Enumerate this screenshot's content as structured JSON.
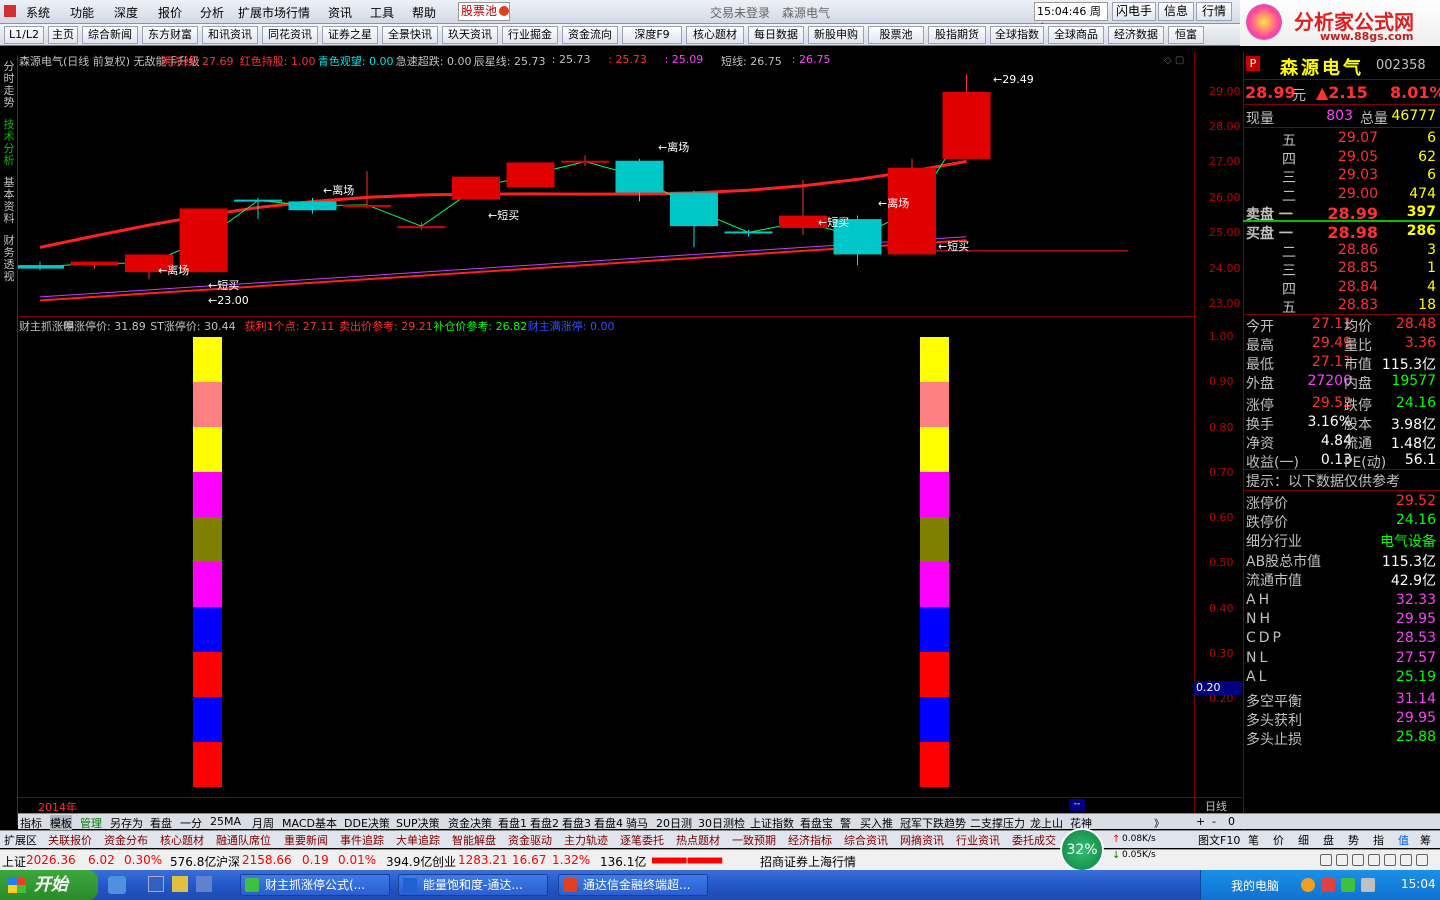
{
  "menu": {
    "items": [
      "系统",
      "功能",
      "深度",
      "报价",
      "分析",
      "扩展市场行情",
      "资讯",
      "工具",
      "帮助"
    ],
    "stockpool": "股票池",
    "status_text": "交易未登录",
    "stock_title": "森源电气",
    "time": "15:04:46",
    "weekday": "周六",
    "right_buttons": [
      "闪电手",
      "信息",
      "行情"
    ],
    "logo": "分析家公式网",
    "logo_url": "www.88gs.com"
  },
  "toolbar": {
    "items": [
      "L1/L2",
      "主页",
      "综合新闻",
      "东方财富",
      "和讯资讯",
      "同花资讯",
      "证券之星",
      "全景快讯",
      "玖天资讯",
      "行业掘金",
      "资金流向",
      "深度F9",
      "核心题材",
      "每日数据",
      "新股申购",
      "股票池",
      "股指期货",
      "全球指数",
      "全球商品",
      "经济数据",
      "恒富"
    ]
  },
  "sidebar": {
    "tabs": [
      "分时走势",
      "技术分析",
      "基本资料",
      "财务透视"
    ]
  },
  "main_chart": {
    "header": [
      {
        "text": "森源电气(日线 前复权) 无敌能手升级",
        "color": "#c0c0c0"
      },
      {
        "text": "拥杀线: 27.69",
        "color": "#ff3030"
      },
      {
        "text": "红色持股: 1.00",
        "color": "#ff3030"
      },
      {
        "text": "青色观望: 0.00",
        "color": "#00e0e0"
      },
      {
        "text": "急速超跌: 0.00",
        "color": "#c0c0c0"
      },
      {
        "text": "辰星线: 25.73",
        "color": "#c0c0c0"
      },
      {
        "text": ": 25.73",
        "color": "#c0c0c0"
      },
      {
        "text": ": 25.73",
        "color": "#ff3030"
      },
      {
        "text": ": 25.09",
        "color": "#ff40ff"
      },
      {
        "text": "短线: 26.75",
        "color": "#c0c0c0"
      },
      {
        "text": ": 26.75",
        "color": "#ff40ff"
      }
    ],
    "y_ticks": [
      "29.00",
      "28.00",
      "27.00",
      "26.00",
      "25.00",
      "24.00",
      "23.00"
    ],
    "annotations": [
      "离场",
      "离场",
      "离场",
      "离场",
      "短买",
      "短买",
      "短买",
      "短买"
    ],
    "price_labels": [
      "29.49",
      "23.00"
    ]
  },
  "sub_chart": {
    "header": [
      {
        "text": "财主抓涨停",
        "color": "#c0c0c0"
      },
      {
        "text": "明涨停价: 31.89",
        "color": "#c0c0c0"
      },
      {
        "text": "ST涨停价: 30.44",
        "color": "#c0c0c0"
      },
      {
        "text": "获利1个点: 27.11",
        "color": "#ff3030"
      },
      {
        "text": "卖出价参考: 29.21",
        "color": "#ff3030"
      },
      {
        "text": "补仓价参考: 26.82",
        "color": "#00ff00"
      },
      {
        "text": "财主满涨停: 0.00",
        "color": "#3050ff"
      }
    ],
    "y_ticks": [
      "1.00",
      "0.90",
      "0.80",
      "0.70",
      "0.60",
      "0.50",
      "0.40",
      "0.30",
      "0.20"
    ],
    "cursor_value": "0.20",
    "year_label": "2014年",
    "axis_tag": "日线"
  },
  "chart_data": {
    "type": "bar",
    "title": "财主抓涨停",
    "columns": [
      {
        "segments": [
          "#ffff00",
          "#ff8080",
          "#ffff00",
          "#ff00ff",
          "#808000",
          "#ff00ff",
          "#0000ff",
          "#ff0000",
          "#0000ff",
          "#ff0000"
        ]
      },
      {
        "segments": [
          "#ffff00",
          "#ff8080",
          "#ffff00",
          "#ff00ff",
          "#808000",
          "#ff00ff",
          "#0000ff",
          "#ff0000",
          "#0000ff",
          "#ff0000"
        ]
      }
    ],
    "ylim": [
      0.2,
      1.0
    ],
    "price_ylim": [
      23.0,
      29.5
    ],
    "candles": [
      {
        "o": 24.1,
        "h": 24.2,
        "c": 24.0,
        "l": 23.95
      },
      {
        "o": 24.1,
        "h": 24.2,
        "c": 24.2,
        "l": 24.0
      },
      {
        "o": 23.9,
        "h": 24.1,
        "c": 24.4,
        "l": 23.7
      },
      {
        "o": 23.9,
        "h": 25.0,
        "c": 25.7,
        "l": 23.9
      },
      {
        "o": 25.95,
        "h": 26.0,
        "c": 25.9,
        "l": 25.4
      },
      {
        "o": 25.9,
        "h": 26.0,
        "c": 25.65,
        "l": 25.55
      },
      {
        "o": 25.8,
        "h": 26.75,
        "c": 25.8,
        "l": 25.7
      },
      {
        "o": 25.2,
        "h": 25.3,
        "c": 25.2,
        "l": 25.1
      },
      {
        "o": 25.95,
        "h": 26.6,
        "c": 26.6,
        "l": 25.95
      },
      {
        "o": 26.3,
        "h": 27.0,
        "c": 27.0,
        "l": 26.3
      },
      {
        "o": 27.0,
        "h": 27.2,
        "c": 27.05,
        "l": 26.9
      },
      {
        "o": 27.05,
        "h": 27.1,
        "c": 26.15,
        "l": 25.9
      },
      {
        "o": 26.15,
        "h": 26.2,
        "c": 25.2,
        "l": 24.6
      },
      {
        "o": 25.05,
        "h": 25.1,
        "c": 25.0,
        "l": 24.9
      },
      {
        "o": 25.15,
        "h": 26.5,
        "c": 25.5,
        "l": 24.95
      },
      {
        "o": 25.4,
        "h": 25.5,
        "c": 24.4,
        "l": 24.1
      },
      {
        "o": 24.4,
        "h": 27.1,
        "c": 26.85,
        "l": 24.4
      },
      {
        "o": 27.1,
        "h": 29.49,
        "c": 28.99,
        "l": 27.11
      }
    ]
  },
  "quote": {
    "flag": "P",
    "name": "森源电气",
    "code": "002358",
    "price": "28.99",
    "unit": "元",
    "change": "▲2.15",
    "pct": "8.01%",
    "now_label": "现量",
    "now_val": "803",
    "total_label": "总量",
    "total_val": "46777",
    "asks": [
      {
        "l": "五",
        "p": "29.07",
        "v": "6"
      },
      {
        "l": "四",
        "p": "29.05",
        "v": "62"
      },
      {
        "l": "三",
        "p": "29.03",
        "v": "6"
      },
      {
        "l": "二",
        "p": "29.00",
        "v": "474"
      },
      {
        "l": "卖盘 一",
        "p": "28.99",
        "v": "397"
      }
    ],
    "bids": [
      {
        "l": "买盘 一",
        "p": "28.98",
        "v": "286"
      },
      {
        "l": "二",
        "p": "28.86",
        "v": "3"
      },
      {
        "l": "三",
        "p": "28.85",
        "v": "1"
      },
      {
        "l": "四",
        "p": "28.84",
        "v": "4"
      },
      {
        "l": "五",
        "p": "28.83",
        "v": "18"
      }
    ],
    "stats": [
      {
        "l1": "今开",
        "v1": "27.11",
        "l2": "均价",
        "v2": "28.48"
      },
      {
        "l1": "最高",
        "v1": "29.49",
        "l2": "量比",
        "v2": "3.36"
      },
      {
        "l1": "最低",
        "v1": "27.11",
        "l2": "市值",
        "v2": "115.3亿"
      },
      {
        "l1": "外盘",
        "v1": "27200",
        "l2": "内盘",
        "v2": "19577"
      },
      {
        "l1": "涨停",
        "v1": "29.52",
        "l2": "跌停",
        "v2": "24.16"
      },
      {
        "l1": "换手",
        "v1": "3.16%",
        "l2": "股本",
        "v2": "3.98亿"
      },
      {
        "l1": "净资",
        "v1": "4.84",
        "l2": "流通",
        "v2": "1.48亿"
      },
      {
        "l1": "收益(一)",
        "v1": "0.13",
        "l2": "PE(动)",
        "v2": "56.1"
      }
    ],
    "tip": "提示：以下数据仅供参考",
    "extra": [
      {
        "l": "涨停价",
        "v": "29.52"
      },
      {
        "l": "跌停价",
        "v": "24.16"
      },
      {
        "l": "细分行业",
        "v": "电气设备"
      },
      {
        "l": "AB股总市值",
        "v": "115.3亿"
      },
      {
        "l": "流通市值",
        "v": "42.9亿"
      },
      {
        "l": "AH",
        "v": "32.33"
      },
      {
        "l": "NH",
        "v": "29.95"
      },
      {
        "l": "CDP",
        "v": "28.53"
      },
      {
        "l": "NL",
        "v": "27.57"
      },
      {
        "l": "AL",
        "v": "25.19"
      },
      {
        "l": "多空平衡",
        "v": "31.14"
      },
      {
        "l": "多头获利",
        "v": "29.95"
      },
      {
        "l": "多头止损",
        "v": "25.88"
      }
    ]
  },
  "tabs1": [
    "指标",
    "模板",
    "管理",
    "另存为",
    "看盘",
    "一分",
    "25MA",
    "月周",
    "MACD基本",
    "DDE决策",
    "SUP决策",
    "资金决策",
    "看盘1",
    "看盘2",
    "看盘3",
    "看盘4",
    "骑马",
    "20日测",
    "30日测检",
    "上证指数",
    "看盘宝",
    "警",
    "买入推",
    "冠军下跌趋势",
    "二支撑压力",
    "龙上山",
    "花神"
  ],
  "tabs1_right": [
    "+",
    "-",
    "0"
  ],
  "tabs2": [
    "扩展区",
    "关联报价",
    "资金分布",
    "核心题材",
    "融通队席位",
    "重要新闻",
    "事件追踪",
    "大单追踪",
    "智能解盘",
    "资金驱动",
    "主力轨迹",
    "逐笔委托",
    "热点题材",
    "一致预期",
    "经济指标",
    "综合资讯",
    "网摘资讯",
    "行业资讯",
    "委托成交",
    "金"
  ],
  "tabs2_right": [
    "图文F10",
    "笔",
    "价",
    "细",
    "盘",
    "势",
    "指",
    "值",
    "筹"
  ],
  "status": {
    "sh_label": "上证",
    "sh_val": "2026.36",
    "sh_chg": "6.02",
    "sh_pct": "0.30%",
    "sh_amt": "576.8亿",
    "sz_label": "沪深",
    "sz_val": "2158.66",
    "sz_chg": "0.19",
    "sz_pct": "0.01%",
    "sz_amt": "394.9亿",
    "cy_label": "创业",
    "cy_val": "1283.21",
    "cy_chg": "16.67",
    "cy_pct": "1.32%",
    "cy_amt": "136.1亿",
    "broker": "招商证券上海行情",
    "net_up": "0.08K/s",
    "net_down": "0.05K/s",
    "cpu": "32%"
  },
  "taskbar": {
    "start": "开始",
    "tasks": [
      "财主抓涨停公式(...",
      "能量饱和度-通达...",
      "通达信金融终端超..."
    ],
    "tray_text": "我的电脑",
    "clock": "15:04"
  }
}
